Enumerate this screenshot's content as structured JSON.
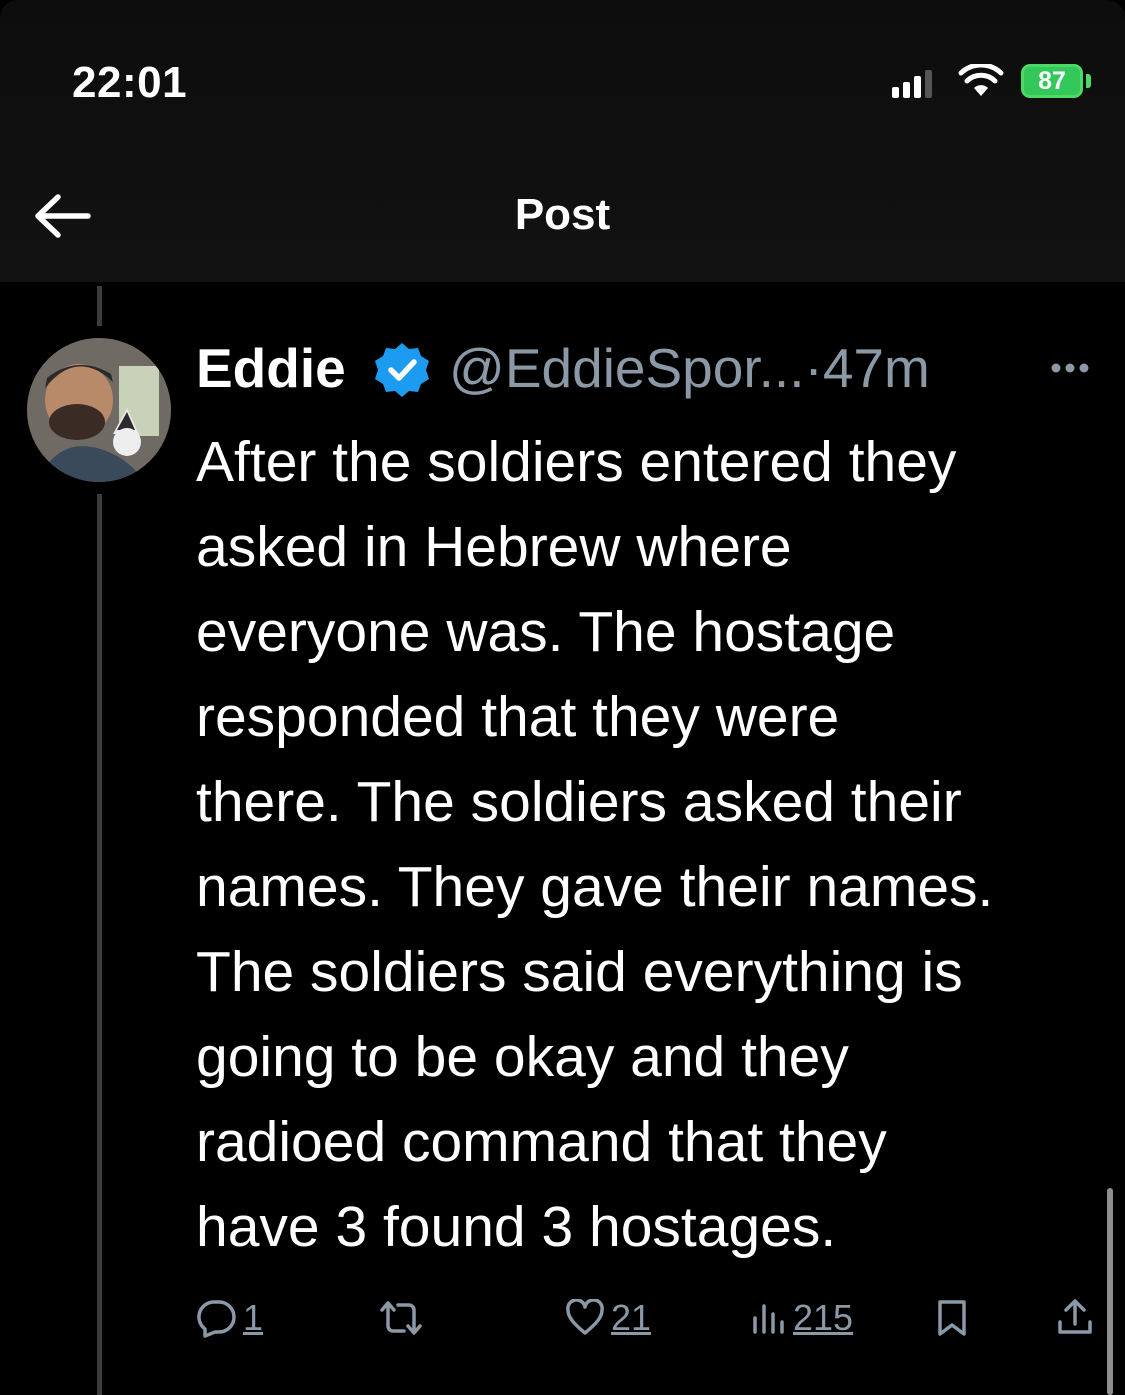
{
  "status_bar": {
    "time": "22:01",
    "battery": "87"
  },
  "header": {
    "title": "Post"
  },
  "tweet": {
    "display_name": "Eddie",
    "handle": "@EddieSpor...",
    "separator": "·",
    "timestamp": "47m",
    "body": "After the soldiers entered they\nasked in Hebrew where\neveryone was. The hostage\nresponded that they were\nthere. The soldiers asked their\nnames. They gave their names.\nThe soldiers said everything is\ngoing to be okay and they\nradioed command that they\nhave 3 found 3 hostages.",
    "verified_color": "#1d9bf0",
    "actions": {
      "replies": "1",
      "likes": "21",
      "views": "215"
    }
  },
  "colors": {
    "background": "#000000",
    "text": "#ffffff",
    "muted": "#8b98a5",
    "battery": "#34c759"
  },
  "icons": [
    "back-arrow-icon",
    "verified-badge-icon",
    "more-icon",
    "reply-icon",
    "repost-icon",
    "like-icon",
    "views-icon",
    "bookmark-icon",
    "share-icon",
    "signal-icon",
    "wifi-icon",
    "battery-icon"
  ]
}
